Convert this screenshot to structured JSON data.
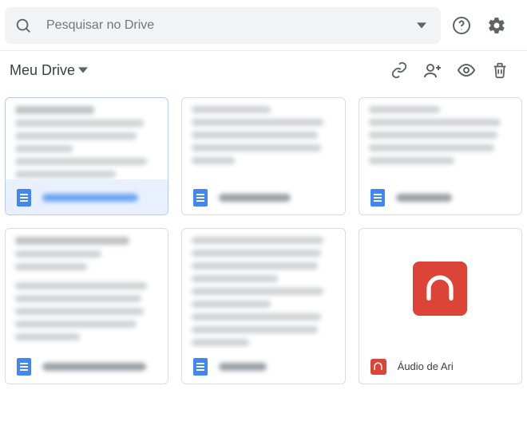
{
  "search": {
    "placeholder": "Pesquisar no Drive"
  },
  "location": {
    "title": "Meu Drive"
  },
  "files": [
    {
      "type": "doc",
      "selected": true
    },
    {
      "type": "doc",
      "selected": false
    },
    {
      "type": "doc",
      "selected": false
    },
    {
      "type": "doc",
      "selected": false
    },
    {
      "type": "doc",
      "selected": false
    },
    {
      "type": "audio",
      "selected": false,
      "title": "Áudio de Ari"
    }
  ]
}
